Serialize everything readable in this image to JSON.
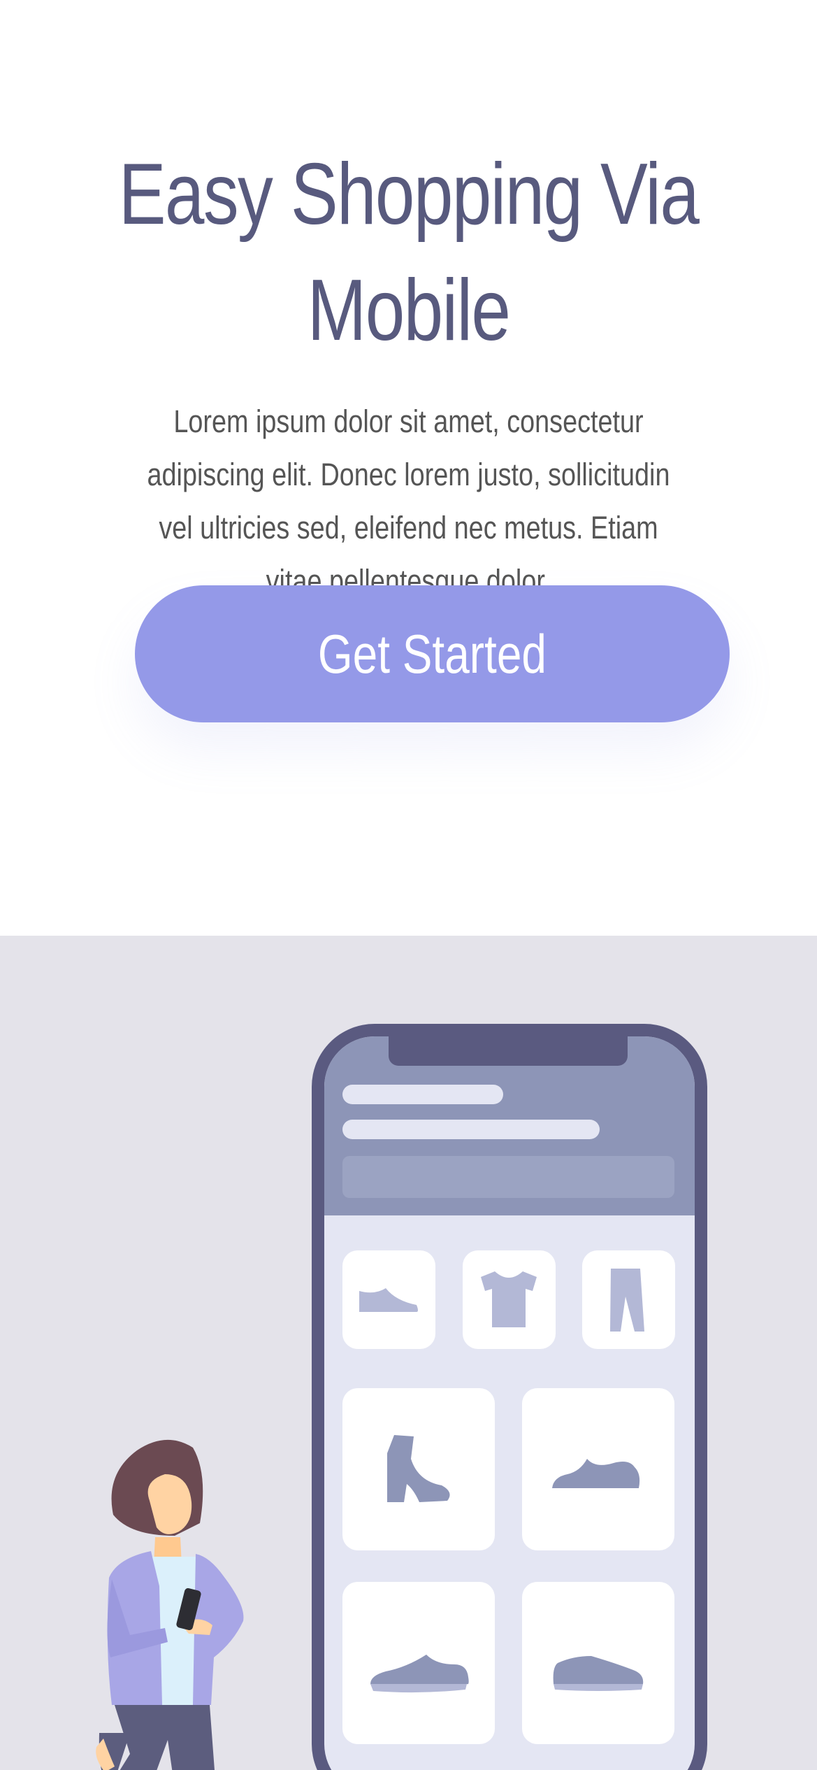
{
  "hero": {
    "title": "Easy Shopping Via Mobile",
    "description": "Lorem ipsum dolor sit amet, consectetur adipiscing elit. Donec lorem justo, sollicitudin vel ultricies sed, eleifend nec metus. Etiam vitae pellentesque dolor.",
    "cta_label": "Get Started"
  },
  "illustration": {
    "icons": [
      "shoe-icon",
      "tshirt-icon",
      "pants-icon",
      "boot-icon",
      "sneaker-icon",
      "sneaker-icon",
      "sneaker-icon"
    ]
  },
  "colors": {
    "heading": "#585a7e",
    "body_text": "#555555",
    "cta_background": "#9499e8",
    "illustration_background": "#e4e3ea",
    "phone_frame": "#5a5a80"
  }
}
